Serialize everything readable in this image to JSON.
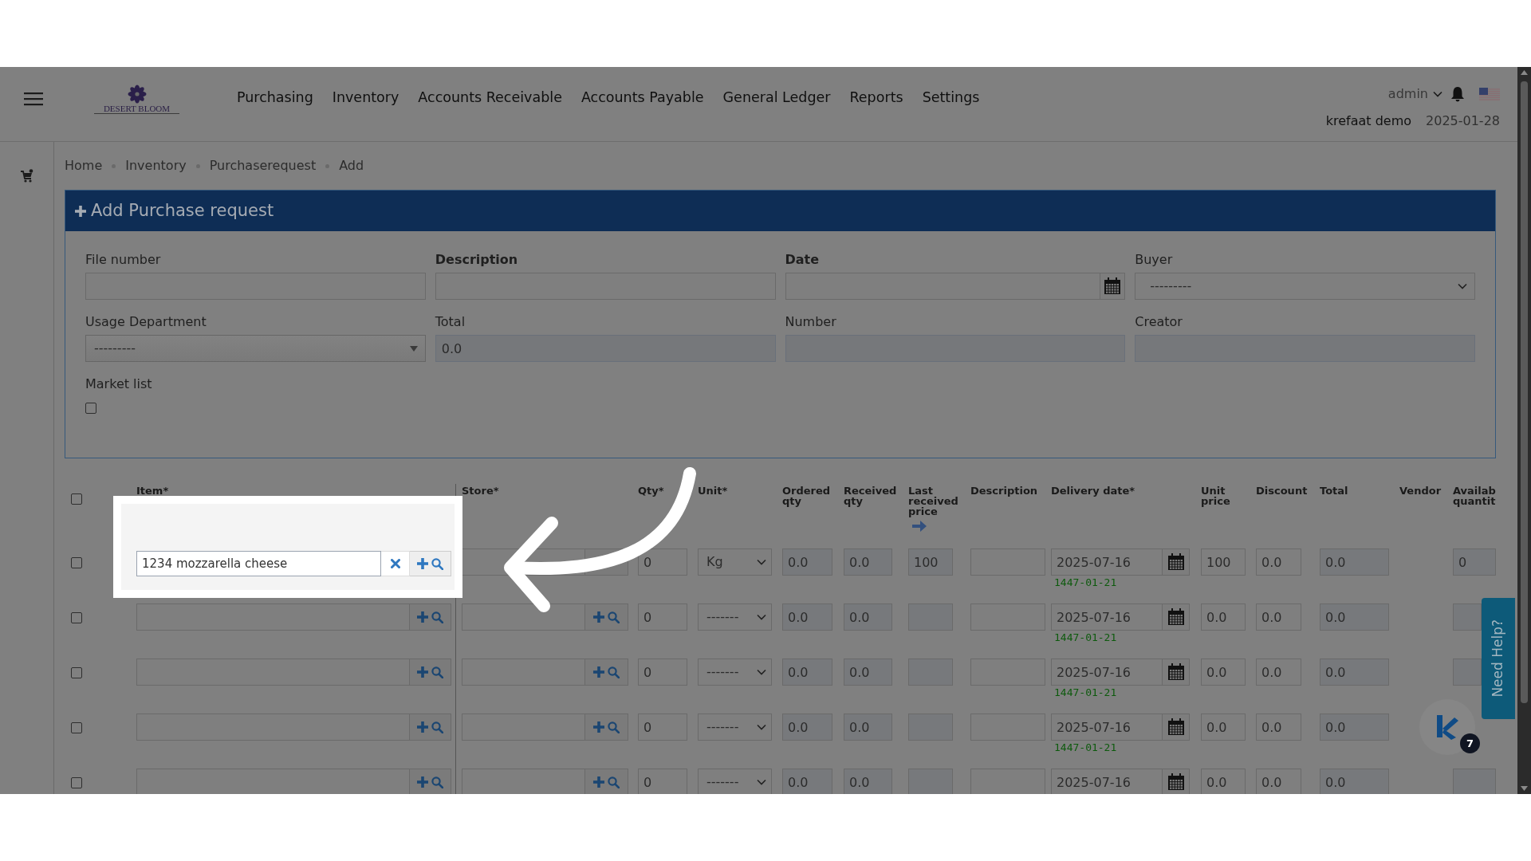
{
  "nav": {
    "logo_text": "DESERT BLOOM",
    "menu": [
      "Purchasing",
      "Inventory",
      "Accounts Receivable",
      "Accounts Payable",
      "General Ledger",
      "Reports",
      "Settings"
    ],
    "user": "admin",
    "company": "krefaat demo",
    "date": "2025-01-28"
  },
  "breadcrumb": [
    "Home",
    "Inventory",
    "Purchaserequest",
    "Add"
  ],
  "form": {
    "title": "Add Purchase request",
    "fields": [
      {
        "label": "File number",
        "kind": "text",
        "required": false
      },
      {
        "label": "Description",
        "kind": "text",
        "required": true
      },
      {
        "label": "Date",
        "kind": "date",
        "required": true
      },
      {
        "label": "Buyer",
        "kind": "select",
        "required": false,
        "value": "---------"
      },
      {
        "label": "Usage Department",
        "kind": "combo",
        "required": false,
        "value": "---------"
      },
      {
        "label": "Total",
        "kind": "readonly",
        "required": false,
        "value": "0.0"
      },
      {
        "label": "Number",
        "kind": "readonly",
        "required": false
      },
      {
        "label": "Creator",
        "kind": "readonly",
        "required": false
      },
      {
        "label": "Market list",
        "kind": "checkbox",
        "required": false,
        "checked": false
      }
    ]
  },
  "table": {
    "select_all_checked": false,
    "columns": [
      "Item*",
      "Store*",
      "Qty*",
      "Unit*",
      "Ordered qty",
      "Received qty",
      "Last received price",
      "Description",
      "Delivery date*",
      "Unit price",
      "Discount",
      "Total",
      "Vendor",
      "Availab quantit"
    ],
    "rows": [
      {
        "checked": false,
        "qty": "0",
        "unit": "Kg",
        "ordered_qty": "0.0",
        "received_qty": "0.0",
        "last_received_price": "100",
        "delivery_date": "2025-07-16",
        "hijri_date": "1447-01-21",
        "unit_price": "100",
        "discount": "0.0",
        "total": "0.0",
        "available_quantity": "0"
      },
      {
        "checked": false,
        "qty": "0",
        "unit": "-------",
        "ordered_qty": "0.0",
        "received_qty": "0.0",
        "delivery_date": "2025-07-16",
        "hijri_date": "1447-01-21",
        "unit_price": "0.0",
        "discount": "0.0",
        "total": "0.0"
      },
      {
        "checked": false,
        "qty": "0",
        "unit": "-------",
        "ordered_qty": "0.0",
        "received_qty": "0.0",
        "delivery_date": "2025-07-16",
        "hijri_date": "1447-01-21",
        "unit_price": "0.0",
        "discount": "0.0",
        "total": "0.0"
      },
      {
        "checked": false,
        "qty": "0",
        "unit": "-------",
        "ordered_qty": "0.0",
        "received_qty": "0.0",
        "delivery_date": "2025-07-16",
        "hijri_date": "1447-01-21",
        "unit_price": "0.0",
        "discount": "0.0",
        "total": "0.0"
      },
      {
        "checked": false,
        "qty": "0",
        "unit": "-------",
        "ordered_qty": "0.0",
        "received_qty": "0.0",
        "delivery_date": "2025-07-16",
        "unit_price": "0.0",
        "discount": "0.0",
        "total": "0.0"
      }
    ]
  },
  "callout": {
    "item": "1234 mozzarella cheese"
  },
  "help": {
    "label": "Need Help?"
  },
  "chat": {
    "badge": "7"
  }
}
